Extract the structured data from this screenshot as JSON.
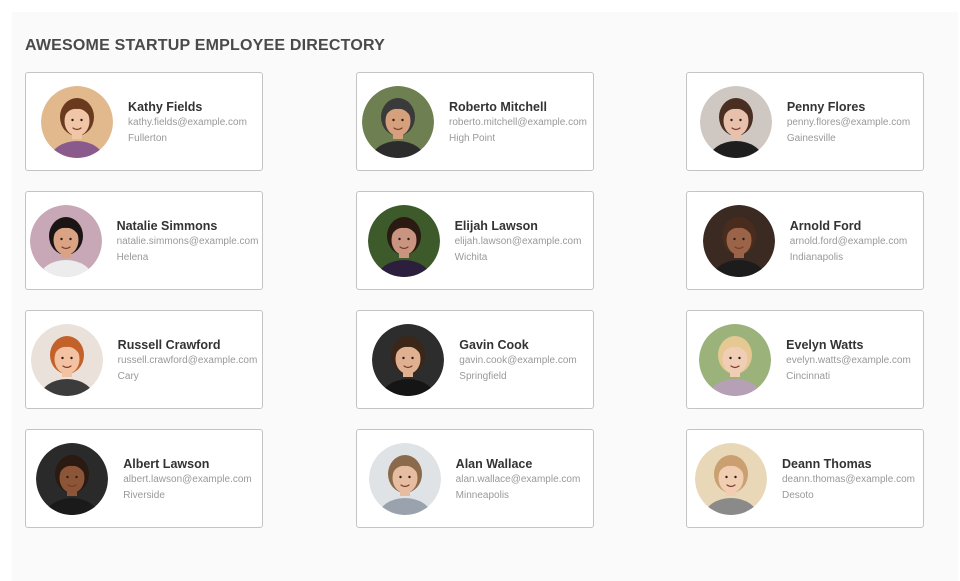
{
  "directory": {
    "title": "AWESOME STARTUP EMPLOYEE DIRECTORY",
    "employees": [
      {
        "name": "Kathy Fields",
        "email": "kathy.fields@example.com",
        "city": "Fullerton",
        "colors": {
          "bg": "#e2b98c",
          "hair": "#6a3a1e",
          "skin": "#f0c6a6",
          "shirt": "#8a5a8c"
        }
      },
      {
        "name": "Roberto Mitchell",
        "email": "roberto.mitchell@example.com",
        "city": "High Point",
        "colors": {
          "bg": "#6e7f52",
          "hair": "#3a3a3a",
          "skin": "#d7a07d",
          "shirt": "#2c2c2c"
        }
      },
      {
        "name": "Penny Flores",
        "email": "penny.flores@example.com",
        "city": "Gainesville",
        "colors": {
          "bg": "#cfc8c2",
          "hair": "#4a2e22",
          "skin": "#e8c1ad",
          "shirt": "#1e1e1e"
        }
      },
      {
        "name": "Natalie Simmons",
        "email": "natalie.simmons@example.com",
        "city": "Helena",
        "colors": {
          "bg": "#c8a7b7",
          "hair": "#1b1414",
          "skin": "#d9a384",
          "shirt": "#ececec"
        }
      },
      {
        "name": "Elijah Lawson",
        "email": "elijah.lawson@example.com",
        "city": "Wichita",
        "colors": {
          "bg": "#3c5a2a",
          "hair": "#2a1a12",
          "skin": "#c99480",
          "shirt": "#2c1f3d"
        }
      },
      {
        "name": "Arnold Ford",
        "email": "arnold.ford@example.com",
        "city": "Indianapolis",
        "colors": {
          "bg": "#3a2a22",
          "hair": "#4a2c1e",
          "skin": "#9b6448",
          "shirt": "#1c1c1c"
        }
      },
      {
        "name": "Russell Crawford",
        "email": "russell.crawford@example.com",
        "city": "Cary",
        "colors": {
          "bg": "#e9e1da",
          "hair": "#c2622a",
          "skin": "#f2c2a2",
          "shirt": "#3c3c3c"
        }
      },
      {
        "name": "Gavin Cook",
        "email": "gavin.cook@example.com",
        "city": "Springfield",
        "colors": {
          "bg": "#2d2d2d",
          "hair": "#3b2618",
          "skin": "#e0b090",
          "shirt": "#151515"
        }
      },
      {
        "name": "Evelyn Watts",
        "email": "evelyn.watts@example.com",
        "city": "Cincinnati",
        "colors": {
          "bg": "#9bb27a",
          "hair": "#e6c893",
          "skin": "#f0cdb5",
          "shirt": "#b6a0b6"
        }
      },
      {
        "name": "Albert Lawson",
        "email": "albert.lawson@example.com",
        "city": "Riverside",
        "colors": {
          "bg": "#2a2a2a",
          "hair": "#2a1a12",
          "skin": "#8c5538",
          "shirt": "#1a1a1a"
        }
      },
      {
        "name": "Alan Wallace",
        "email": "alan.wallace@example.com",
        "city": "Minneapolis",
        "colors": {
          "bg": "#dfe3e6",
          "hair": "#8a6a4a",
          "skin": "#e6bda0",
          "shirt": "#9aa3ad"
        }
      },
      {
        "name": "Deann Thomas",
        "email": "deann.thomas@example.com",
        "city": "Desoto",
        "colors": {
          "bg": "#e9d8b8",
          "hair": "#caa070",
          "skin": "#f1cdb2",
          "shirt": "#8a8a8a"
        }
      }
    ]
  }
}
